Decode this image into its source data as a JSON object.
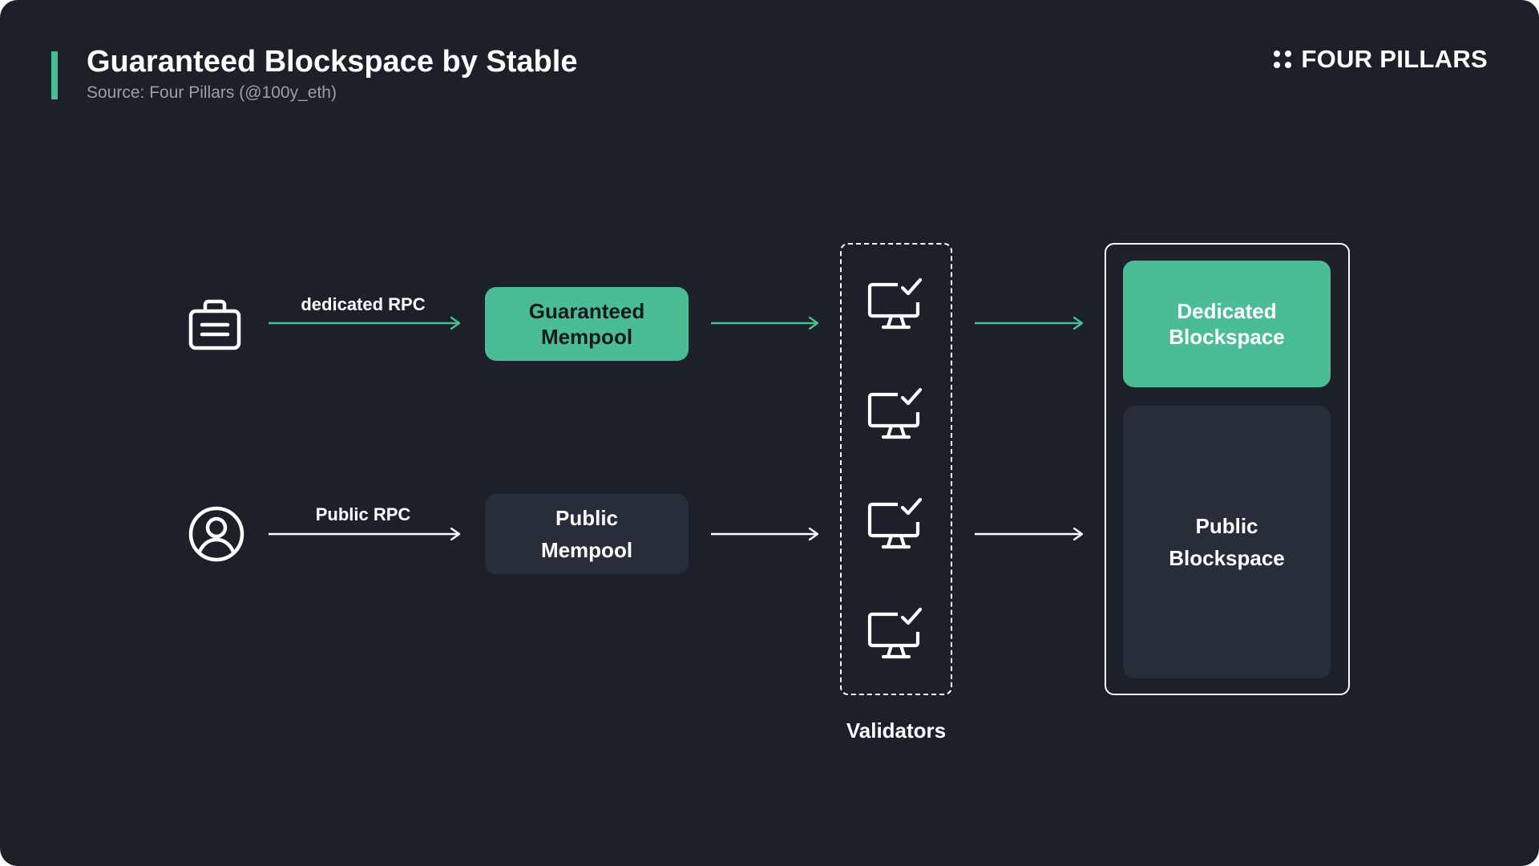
{
  "header": {
    "title": "Guaranteed Blockspace by Stable",
    "subtitle": "Source: Four Pillars (@100y_eth)"
  },
  "brand": {
    "name": "FOUR PILLARS"
  },
  "flows": {
    "top": {
      "source_icon": "briefcase-icon",
      "rpc_label": "dedicated RPC",
      "mempool_line1": "Guaranteed",
      "mempool_line2": "Mempool"
    },
    "bottom": {
      "source_icon": "user-icon",
      "rpc_label": "Public RPC",
      "mempool_line1": "Public",
      "mempool_line2": "Mempool"
    }
  },
  "validators": {
    "label": "Validators",
    "icon": "monitor-check-icon"
  },
  "blockspace": {
    "dedicated_line1": "Dedicated",
    "dedicated_line2": "Blockspace",
    "public_line1": "Public",
    "public_line2": "Blockspace"
  },
  "colors": {
    "background": "#1c2029",
    "accent": "#4bbd94",
    "panel_dark": "#272d39",
    "text_muted": "#9aa0a8",
    "text": "#ffffff"
  }
}
